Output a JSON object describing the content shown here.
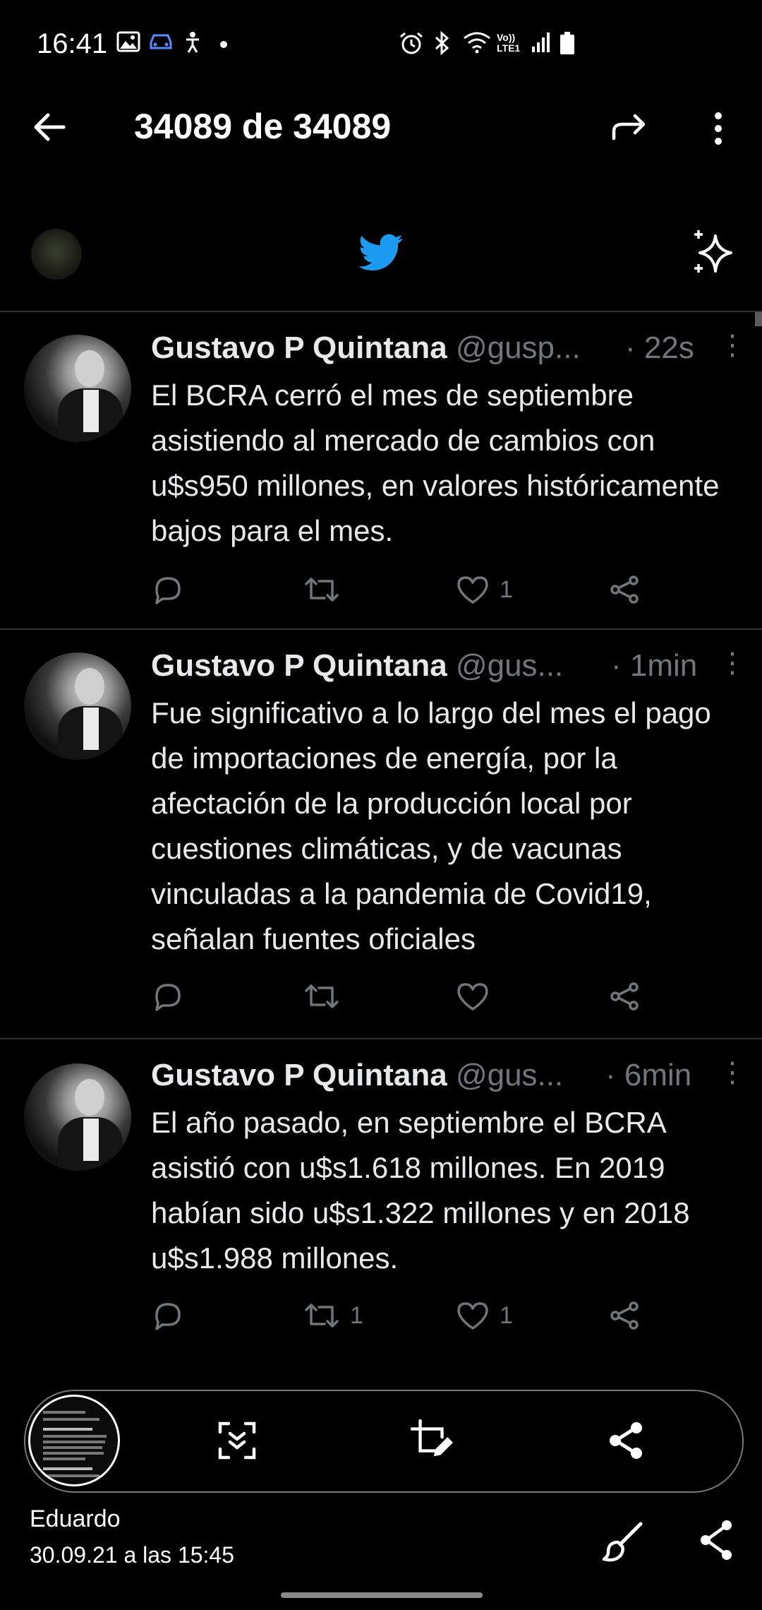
{
  "status_bar": {
    "time": "16:41",
    "left_icons": [
      "image-icon",
      "car-icon",
      "accessibility-icon",
      "dot-icon"
    ],
    "right_icons": [
      "alarm-icon",
      "bluetooth-icon",
      "wifi-icon",
      "volte-icon",
      "signal-icon",
      "battery-icon"
    ],
    "volte_label_top": "Vo))",
    "volte_label_bottom": "LTE1"
  },
  "viewer": {
    "counter": "34089 de 34089"
  },
  "twitter": {
    "logo": "twitter-bird-icon",
    "sparkle": "sparkle-icon"
  },
  "tweets": [
    {
      "name": "Gustavo P Quintana",
      "handle": "@gusp...",
      "time": "· 22s",
      "text": "El BCRA cerró el mes de septiembre asistiendo al mercado de cambios con u$s950 millones, en valores históricamente bajos para el mes.",
      "replies": "",
      "retweets": "",
      "likes": "1"
    },
    {
      "name": "Gustavo P Quintana",
      "handle": "@gus...",
      "time": "· 1min",
      "text": "Fue significativo a lo largo del mes el pago de importaciones de energía, por la afectación de la producción local por cuestiones climáticas, y de vacunas vinculadas a la pandemia de Covid19, señalan fuentes oficiales",
      "replies": "",
      "retweets": "",
      "likes": ""
    },
    {
      "name": "Gustavo P Quintana",
      "handle": "@gus...",
      "time": "· 6min",
      "text": "El año pasado, en septiembre el BCRA asistió con u$s1.618 millones. En 2019 habían sido u$s1.322 millones y en 2018 u$s1.988 millones.",
      "replies": "",
      "retweets": "1",
      "likes": "1"
    }
  ],
  "bottom": {
    "author": "Eduardo",
    "datetime": "30.09.21 a las 15:45"
  }
}
